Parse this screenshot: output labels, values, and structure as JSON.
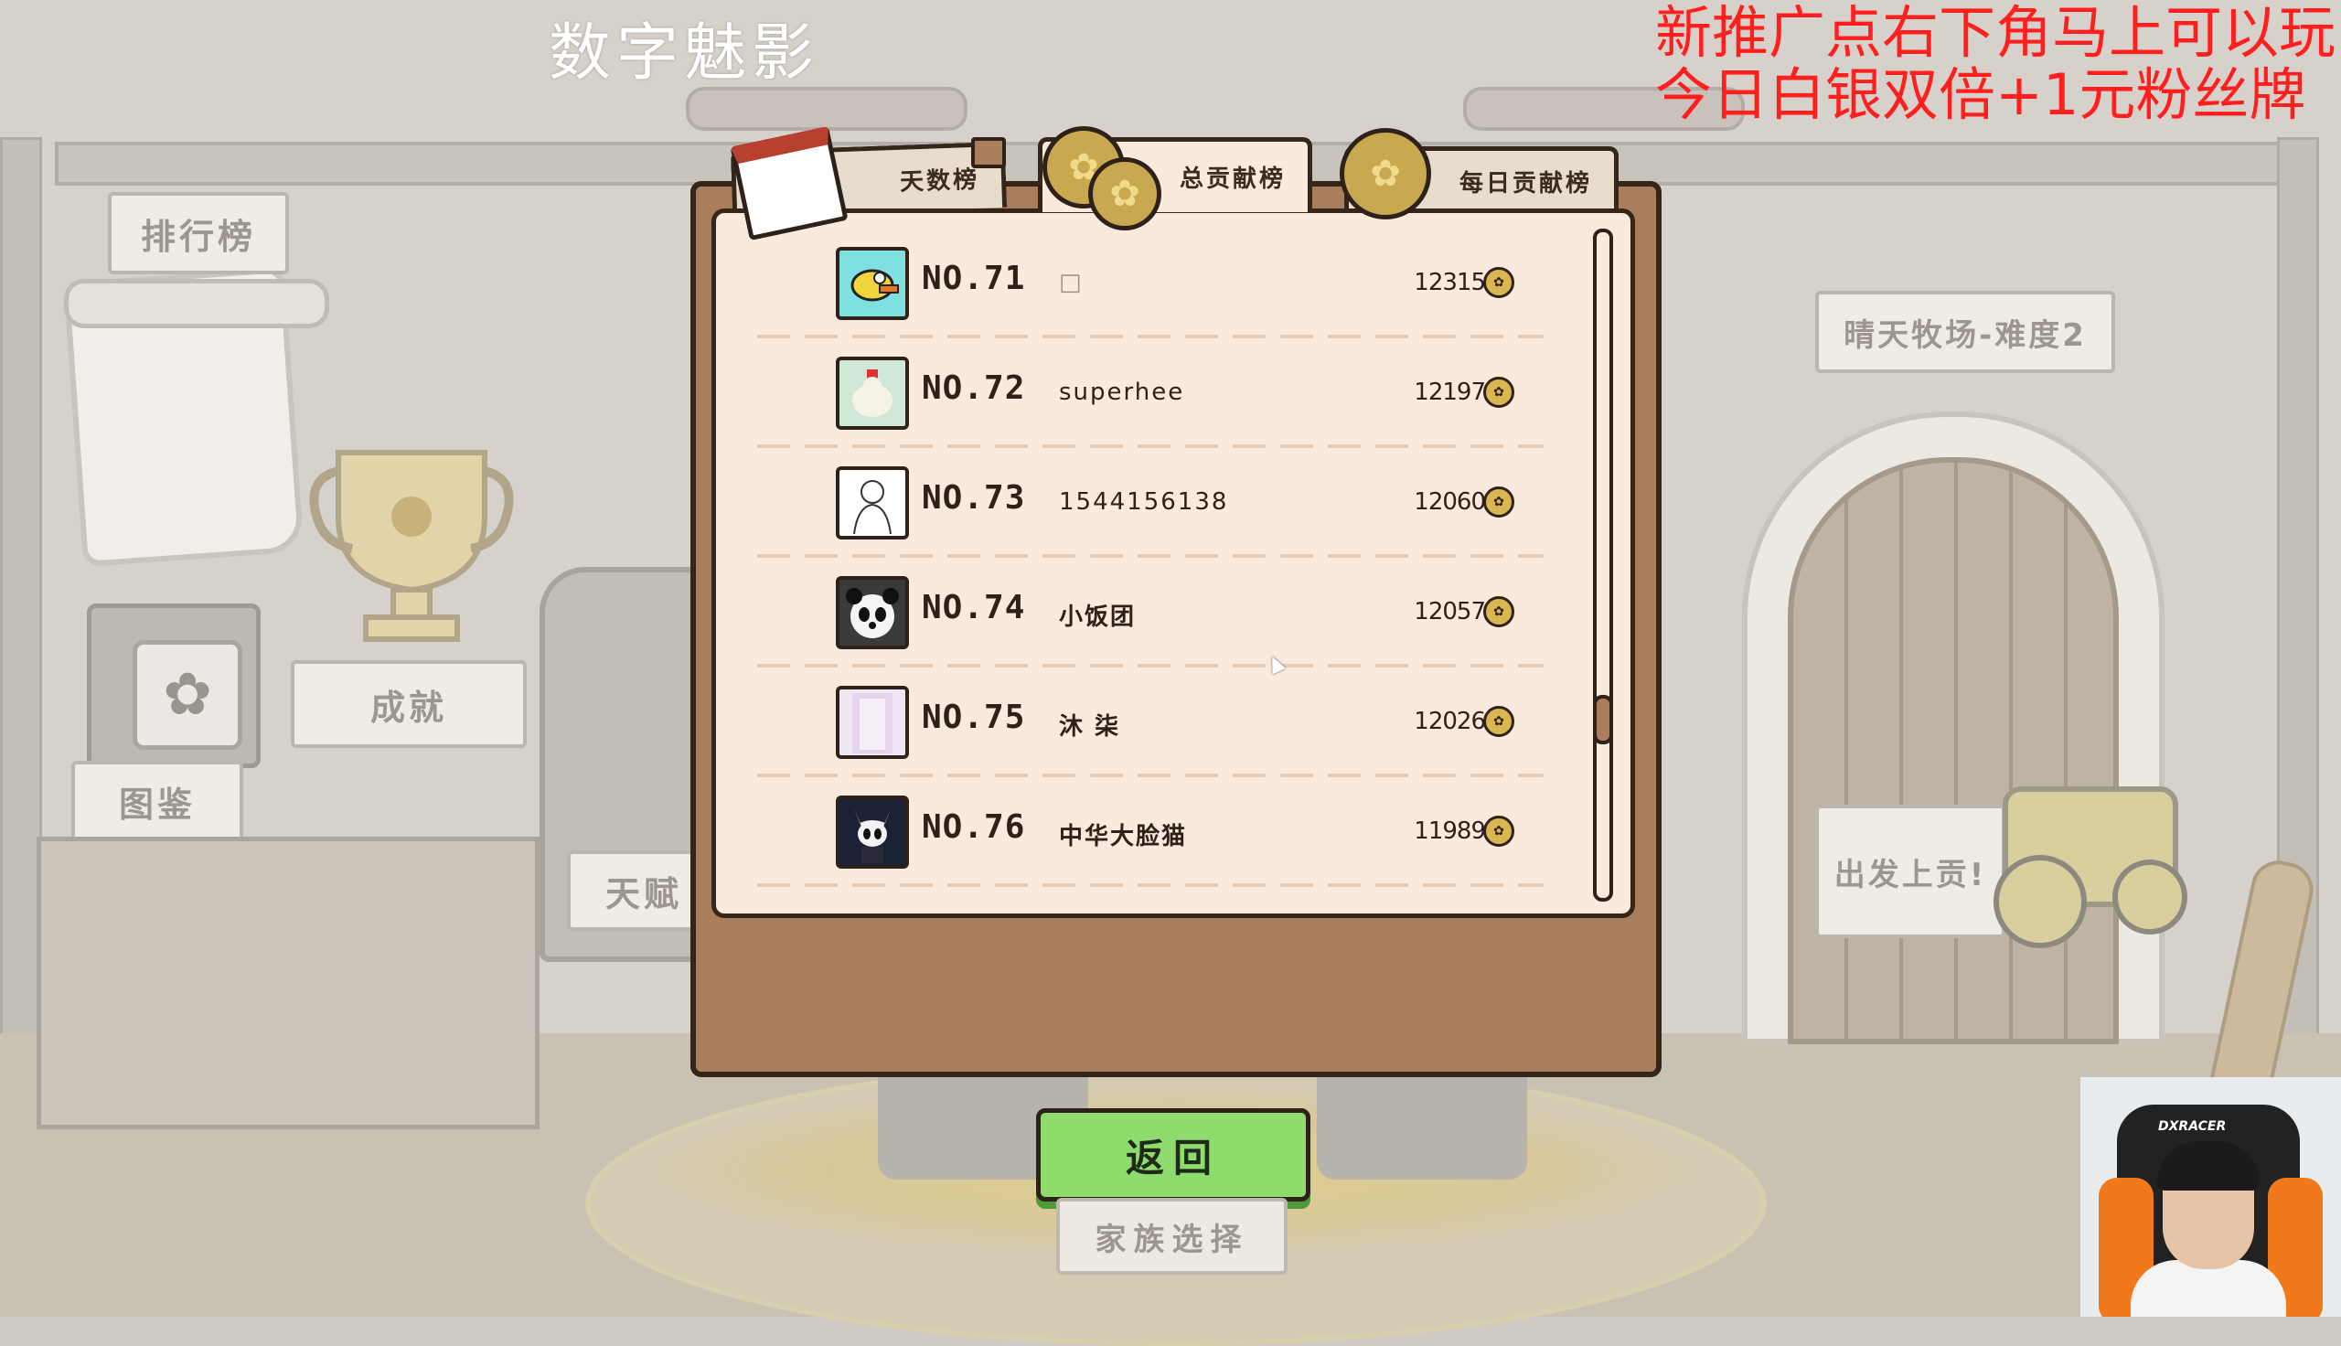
{
  "overlay": {
    "stream_title": "数字魅影",
    "promo_line1": "新推广点右下角马上可以玩",
    "promo_line2": "今日白银双倍+1元粉丝牌"
  },
  "background_labels": {
    "leaderboard": "排行榜",
    "achievements": "成就",
    "codex": "图鉴",
    "talent": "天赋",
    "ranch": "晴天牧场-难度2",
    "depart": "出发上贡!"
  },
  "tabs": [
    {
      "label": "天数榜",
      "locked": true
    },
    {
      "label": "总贡献榜",
      "active": true
    },
    {
      "label": "每日贡献榜"
    }
  ],
  "rows": [
    {
      "rank": "NO.71",
      "name": "□",
      "score": "12315",
      "avatar": "bird-avatar"
    },
    {
      "rank": "NO.72",
      "name": "superhee",
      "score": "12197",
      "avatar": "chicken-avatar"
    },
    {
      "rank": "NO.73",
      "name": "1544156138",
      "score": "12060",
      "avatar": "sketch-avatar"
    },
    {
      "rank": "NO.74",
      "name": "小饭团",
      "score": "12057",
      "avatar": "panda-avatar"
    },
    {
      "rank": "NO.75",
      "name": "沐 柒",
      "score": "12026",
      "avatar": "anime-avatar"
    },
    {
      "rank": "NO.76",
      "name": "中华大脸猫",
      "score": "11989",
      "avatar": "knight-avatar"
    }
  ],
  "buttons": {
    "back": "返回",
    "family_select": "家族选择"
  },
  "webcam": {
    "chair_brand": "DXRACER"
  },
  "colors": {
    "panel_bg": "#faeadd",
    "panel_frame": "#a97e5d",
    "back_button": "#8edc6e",
    "promo_text": "#ff1f1f"
  }
}
